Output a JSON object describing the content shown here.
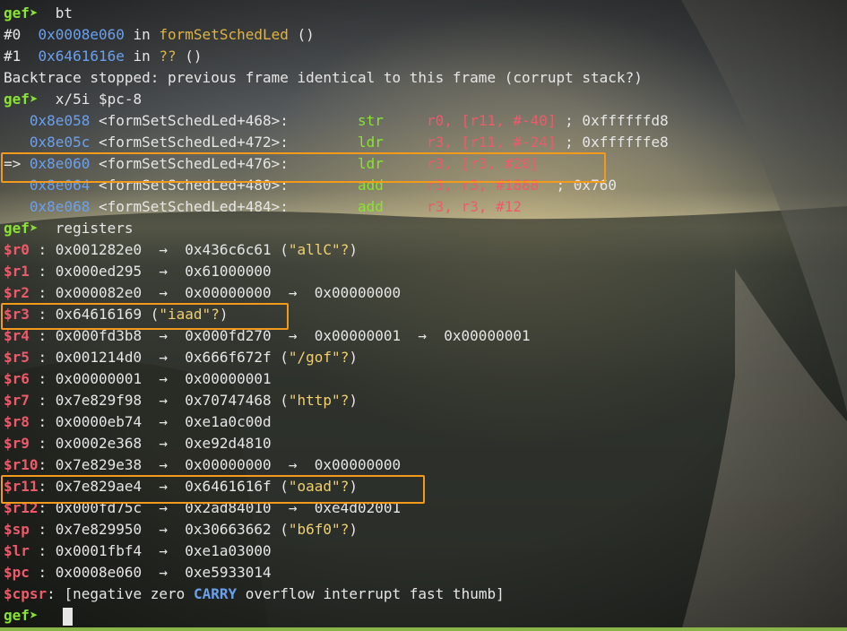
{
  "prompt": "gef➤",
  "lines": {
    "l1_cmd": "  bt",
    "l2_idx": "#0  ",
    "l2_addr": "0x0008e060",
    "l2_in": " in ",
    "l2_func": "formSetSchedLed",
    "l2_args": " ()",
    "l3_idx": "#1  ",
    "l3_addr": "0x6461616e",
    "l3_in": " in ",
    "l3_func": "??",
    "l3_args": " ()",
    "l4_text": "Backtrace stopped: previous frame identical to this frame (corrupt stack?)",
    "l5_cmd": "  x/5i $pc-8",
    "disasm": [
      {
        "prefix": "   ",
        "addr": "0x8e058",
        "sym": " <formSetSchedLed+468>:        ",
        "mnem": "str     ",
        "ops": "r0, [r11, #-40]",
        "comment": " ; 0xffffffd8"
      },
      {
        "prefix": "   ",
        "addr": "0x8e05c",
        "sym": " <formSetSchedLed+472>:        ",
        "mnem": "ldr     ",
        "ops": "r3, [r11, #-24]",
        "comment": " ; 0xffffffe8"
      },
      {
        "prefix": "=> ",
        "addr": "0x8e060",
        "sym": " <formSetSchedLed+476>:        ",
        "mnem": "ldr     ",
        "ops": "r3, [r3, #20]",
        "comment": ""
      },
      {
        "prefix": "   ",
        "addr": "0x8e064",
        "sym": " <formSetSchedLed+480>:        ",
        "mnem": "add     ",
        "ops": "r3, r3, #1888",
        "comment": "  ; 0x760"
      },
      {
        "prefix": "   ",
        "addr": "0x8e068",
        "sym": " <formSetSchedLed+484>:        ",
        "mnem": "add     ",
        "ops": "r3, r3, #12",
        "comment": ""
      }
    ],
    "l11_cmd": "  registers",
    "regs": [
      {
        "name": "$r0 ",
        "val": ": 0x001282e0  →  0x436c6c61 (",
        "str": "\"allC\"?",
        "tail": ")"
      },
      {
        "name": "$r1 ",
        "val": ": 0x000ed295  →  0x61000000",
        "str": "",
        "tail": ""
      },
      {
        "name": "$r2 ",
        "val": ": 0x000082e0  →  0x00000000  →  0x00000000",
        "str": "",
        "tail": ""
      },
      {
        "name": "$r3 ",
        "val": ": 0x64616169 (",
        "str": "\"iaad\"?",
        "tail": ")"
      },
      {
        "name": "$r4 ",
        "val": ": 0x000fd3b8  →  0x000fd270  →  0x00000001  →  0x00000001",
        "str": "",
        "tail": ""
      },
      {
        "name": "$r5 ",
        "val": ": 0x001214d0  →  0x666f672f (",
        "str": "\"/gof\"?",
        "tail": ")"
      },
      {
        "name": "$r6 ",
        "val": ": 0x00000001  →  0x00000001",
        "str": "",
        "tail": ""
      },
      {
        "name": "$r7 ",
        "val": ": 0x7e829f98  →  0x70747468 (",
        "str": "\"http\"?",
        "tail": ")"
      },
      {
        "name": "$r8 ",
        "val": ": 0x0000eb74  →  0xe1a0c00d",
        "str": "",
        "tail": ""
      },
      {
        "name": "$r9 ",
        "val": ": 0x0002e368  →  0xe92d4810",
        "str": "",
        "tail": ""
      },
      {
        "name": "$r10",
        "val": ": 0x7e829e38  →  0x00000000  →  0x00000000",
        "str": "",
        "tail": ""
      },
      {
        "name": "$r11",
        "val": ": 0x7e829ae4  →  0x6461616f (",
        "str": "\"oaad\"?",
        "tail": ")"
      },
      {
        "name": "$r12",
        "val": ": 0x000fd75c  →  0x2ad84010  →  0xe4d02001",
        "str": "",
        "tail": ""
      },
      {
        "name": "$sp ",
        "val": ": 0x7e829950  →  0x30663662 (",
        "str": "\"b6f0\"?",
        "tail": ")"
      },
      {
        "name": "$lr ",
        "val": ": 0x0001fbf4  →  0xe1a03000",
        "str": "",
        "tail": ""
      },
      {
        "name": "$pc ",
        "val": ": 0x0008e060  →  0xe5933014",
        "str": "",
        "tail": ""
      }
    ],
    "cpsr_name": "$cpsr",
    "cpsr_a": ": [negative zero ",
    "cpsr_carry": "CARRY",
    "cpsr_b": " overflow interrupt fast thumb]"
  },
  "colors": {
    "highlight": "#f39a1c",
    "prompt": "#8ae234",
    "address": "#6aa0ee",
    "function": "#e0b341",
    "register_name": "#ef5a6a"
  }
}
